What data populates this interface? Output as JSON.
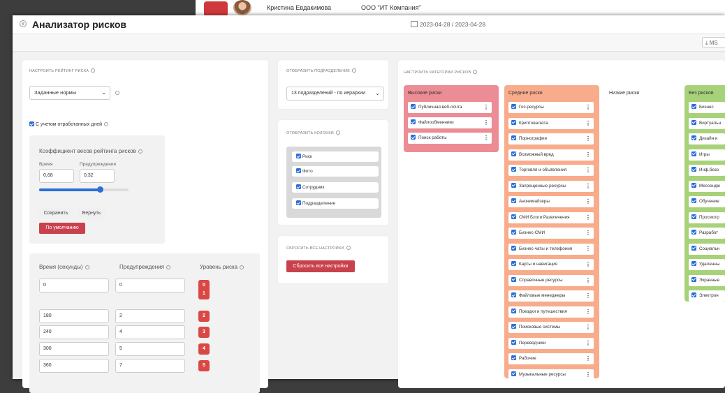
{
  "background": {
    "employee_name": "Кристина Евдакимова",
    "company": "ООО \"ИТ Компания\""
  },
  "header": {
    "title": "Анализатор рисков",
    "date_range": "2023-04-28 / 2023-04-28",
    "export_label": "MS"
  },
  "risk_rating": {
    "section_label": "Настроить рейтинг риска",
    "norm_select": "Заданные нормы",
    "worked_days_label": "С учетом отработанных дней",
    "weights": {
      "title": "Коэффициент весов рейтинга рисков",
      "time_label": "Время",
      "warn_label": "Предупреждения",
      "time_value": "0,68",
      "warn_value": "0,32",
      "slider_fraction": 0.68,
      "save": "Сохранить",
      "revert": "Вернуть",
      "defaults": "По умолчанию"
    },
    "levels": {
      "col_time": "Время (секунды)",
      "col_warn": "Предупреждения",
      "col_level": "Уровень риска",
      "rows": [
        {
          "time": "0",
          "warn": "0",
          "level": "0"
        },
        {
          "time": "",
          "warn": "",
          "level": "1"
        },
        {
          "time": "180",
          "warn": "2",
          "level": "2"
        },
        {
          "time": "240",
          "warn": "4",
          "level": "3"
        },
        {
          "time": "300",
          "warn": "5",
          "level": "4"
        },
        {
          "time": "360",
          "warn": "7",
          "level": "5"
        }
      ]
    }
  },
  "division": {
    "section_label": "Отобразить подразделение",
    "select_value": "13 подразделений - по иерархии"
  },
  "columns": {
    "section_label": "Отобразить колонки",
    "items": [
      "Риск",
      "Фото",
      "Сотрудник",
      "Подразделение"
    ]
  },
  "reset": {
    "section_label": "Сбросить все настройки",
    "button": "Сбросить все настройки"
  },
  "categories": {
    "section_label": "Настроить категории рисков",
    "colors": {
      "high": "#ec8c95",
      "medium": "#f8ac8c",
      "low": "#fbd57a",
      "none": "#a7d27a"
    },
    "high": {
      "title": "Высокие риски",
      "items": [
        "Публичная веб-почта",
        "Файлообменники",
        "Поиск работы"
      ]
    },
    "medium": {
      "title": "Средние риски",
      "items": [
        "Гос.ресурсы",
        "Криптовалюта",
        "Порнография",
        "Возможный вред",
        "Торговля и объявления",
        "Запрещенные ресурсы",
        "Анонимайзеры",
        "СМИ Блоги Развлечения",
        "Бизнес-СМИ",
        "Бизнес-чаты и телефония",
        "Карты и навигация",
        "Справочные ресурсы",
        "Файловые менеджеры",
        "Поездки и путешествия",
        "Поисковые системы",
        "Переводчики",
        "Рабочие",
        "Музыкальные ресурсы"
      ]
    },
    "low": {
      "title": "Низкие риски",
      "items": []
    },
    "none": {
      "title": "Без рисков",
      "items": [
        "Бизнес",
        "Виртуальн",
        "Дизайн и",
        "Игры",
        "Инф.безо",
        "Мессендж",
        "Обучение",
        "Просмотр",
        "Разработ",
        "Социальн",
        "Удаленны",
        "Экранные",
        "Электрон"
      ]
    }
  }
}
